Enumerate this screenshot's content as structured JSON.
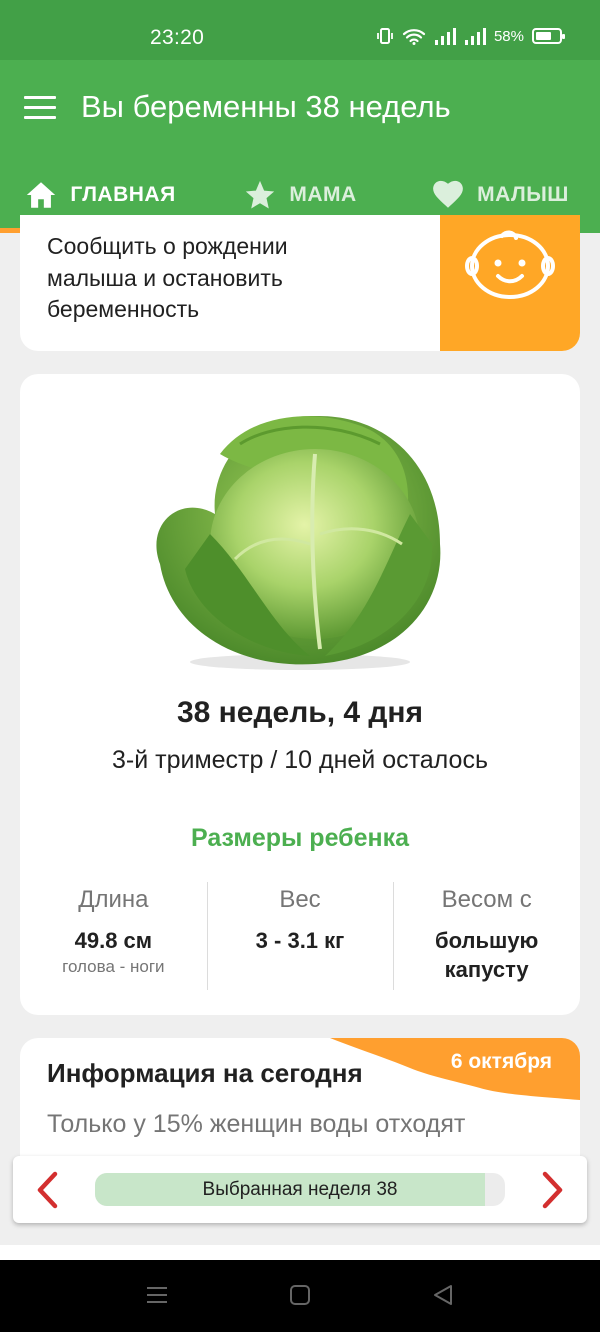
{
  "status_bar": {
    "time": "23:20",
    "battery_label": "58%",
    "battery_level": 0.58
  },
  "app_bar": {
    "title": "Вы беременны 38 недель"
  },
  "tabs": [
    {
      "label": "ГЛАВНАЯ",
      "icon": "home-icon",
      "active": true
    },
    {
      "label": "МАМА",
      "icon": "star-icon",
      "active": false
    },
    {
      "label": "МАЛЫШ",
      "icon": "heart-icon",
      "active": false
    }
  ],
  "report_card": {
    "text": "Сообщить о рождении малыша и остановить беременность",
    "icon": "baby-face-icon"
  },
  "week_card": {
    "image": "cabbage-image",
    "title": "38 недель, 4 дня",
    "subtitle": "3-й триместр / 10 дней осталось",
    "sizes_title": "Размеры ребенка",
    "metrics": [
      {
        "label": "Длина",
        "value": "49.8 см",
        "note": "голова - ноги"
      },
      {
        "label": "Вес",
        "value": "3 - 3.1 кг",
        "note": ""
      },
      {
        "label": "Весом с",
        "value": "большую капусту",
        "note": ""
      }
    ]
  },
  "info_card": {
    "title": "Информация на сегодня",
    "date": "6 октября",
    "text": "Только у 15% женщин воды отходят"
  },
  "week_selector": {
    "label": "Выбранная неделя 38",
    "progress": 0.95
  },
  "colors": {
    "primary": "#4caf50",
    "status_bar": "#42a047",
    "accent": "#ffa726",
    "ribbon": "#ff9f2f",
    "arrow": "#d32f2f"
  }
}
